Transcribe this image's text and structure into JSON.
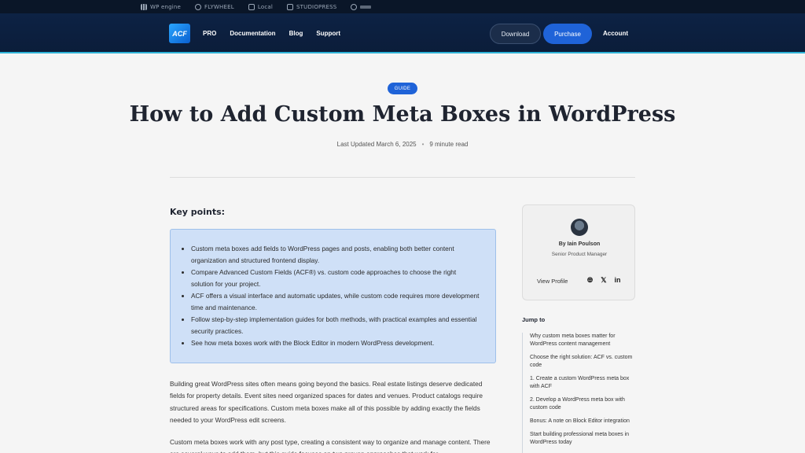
{
  "topstrip": {
    "brands": [
      "WP engine",
      "FLYWHEEL",
      "Local",
      "STUDIOPRESS",
      ""
    ]
  },
  "header": {
    "logo": "ACF",
    "nav": [
      "PRO",
      "Documentation",
      "Blog",
      "Support"
    ],
    "download": "Download",
    "purchase": "Purchase",
    "account": "Account"
  },
  "hero": {
    "badge": "GUIDE",
    "title": "How to Add Custom Meta Boxes in WordPress",
    "updated": "Last Updated March 6, 2025",
    "read_time": "9 minute read"
  },
  "main": {
    "keypoints_heading": "Key points:",
    "keypoints": [
      "Custom meta boxes add fields to WordPress pages and posts, enabling both better content organization and structured frontend display.",
      "Compare Advanced Custom Fields (ACF®) vs. custom code approaches to choose the right solution for your project.",
      "ACF offers a visual interface and automatic updates, while custom code requires more development time and maintenance.",
      "Follow step-by-step implementation guides for both methods, with practical examples and essential security practices.",
      "See how meta boxes work with the Block Editor in modern WordPress development."
    ],
    "para1": "Building great WordPress sites often means going beyond the basics. Real estate listings deserve dedicated fields for property details. Event sites need organized spaces for dates and venues. Product catalogs require structured areas for specifications. Custom meta boxes make all of this possible by adding exactly the fields needed to your WordPress edit screens.",
    "para2": "Custom meta boxes work with any post type, creating a consistent way to organize and manage content. There are several ways to add them, but this guide focuses on two proven approaches that work for"
  },
  "sidebar": {
    "author_name": "By Iain Poulson",
    "author_role": "Senior Product Manager",
    "view_profile": "View Profile",
    "socials": [
      "globe-icon",
      "x-icon",
      "linkedin-icon"
    ],
    "jump_heading": "Jump to",
    "toc": [
      "Why custom meta boxes matter for WordPress content management",
      "Choose the right solution: ACF vs. custom code",
      "1. Create a custom WordPress meta box with ACF",
      "2. Develop a WordPress meta box with custom code",
      "Bonus: A note on Block Editor integration",
      "Start building professional meta boxes in WordPress today"
    ]
  }
}
